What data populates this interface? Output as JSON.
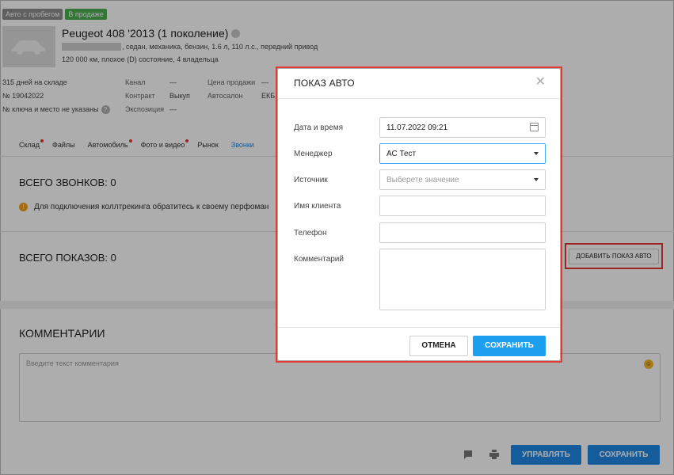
{
  "car": {
    "badges": [
      "Авто с пробегом",
      "В продаже"
    ],
    "title": "Peugeot 408 '2013 (1 поколение)",
    "description": ", седан, механика, бензин, 1.6 л, 110 л.с., передний привод",
    "mileage": "120 000 км, плохое (D) состояние, 4 владельца"
  },
  "meta": {
    "col1": [
      "315 дней на складе",
      "№ 19042022",
      "№ ключа и место не указаны"
    ],
    "col2_labels": [
      "Канал",
      "Контракт",
      "Экспозиция"
    ],
    "col2_values": [
      "—",
      "Выкуп",
      "—"
    ],
    "col3_labels": [
      "Цена продажи",
      "Автосалон"
    ],
    "col3_values": [
      "—",
      "ЕКБ"
    ]
  },
  "tabs": [
    {
      "label": "Склад",
      "dot": true
    },
    {
      "label": "Файлы",
      "dot": false
    },
    {
      "label": "Автомобиль",
      "dot": true
    },
    {
      "label": "Фото и видео",
      "dot": true
    },
    {
      "label": "Рынок",
      "dot": false
    },
    {
      "label": "Звонки",
      "dot": false
    }
  ],
  "calls": {
    "title": "ВСЕГО ЗВОНКОВ: 0",
    "notice": "Для подключения коллтрекинга обратитесь к своему перфоман"
  },
  "shows": {
    "title": "ВСЕГО ПОКАЗОВ: 0",
    "add_button": "ДОБАВИТЬ ПОКАЗ АВТО"
  },
  "comments": {
    "title": "КОММЕНТАРИИ",
    "placeholder": "Введите текст комментария"
  },
  "bottom": {
    "manage_button": "УПРАВЛЯТЬ",
    "save_button": "СОХРАНИТЬ"
  },
  "modal": {
    "title": "ПОКАЗ АВТО",
    "fields": {
      "datetime_label": "Дата и время",
      "datetime_value": "11.07.2022 09:21",
      "manager_label": "Менеджер",
      "manager_value": "АС Тест",
      "source_label": "Источник",
      "source_placeholder": "Выберете значение",
      "client_label": "Имя клиента",
      "phone_label": "Телефон",
      "comment_label": "Комментарий"
    },
    "cancel": "ОТМЕНА",
    "save": "СОХРАНИТЬ"
  }
}
